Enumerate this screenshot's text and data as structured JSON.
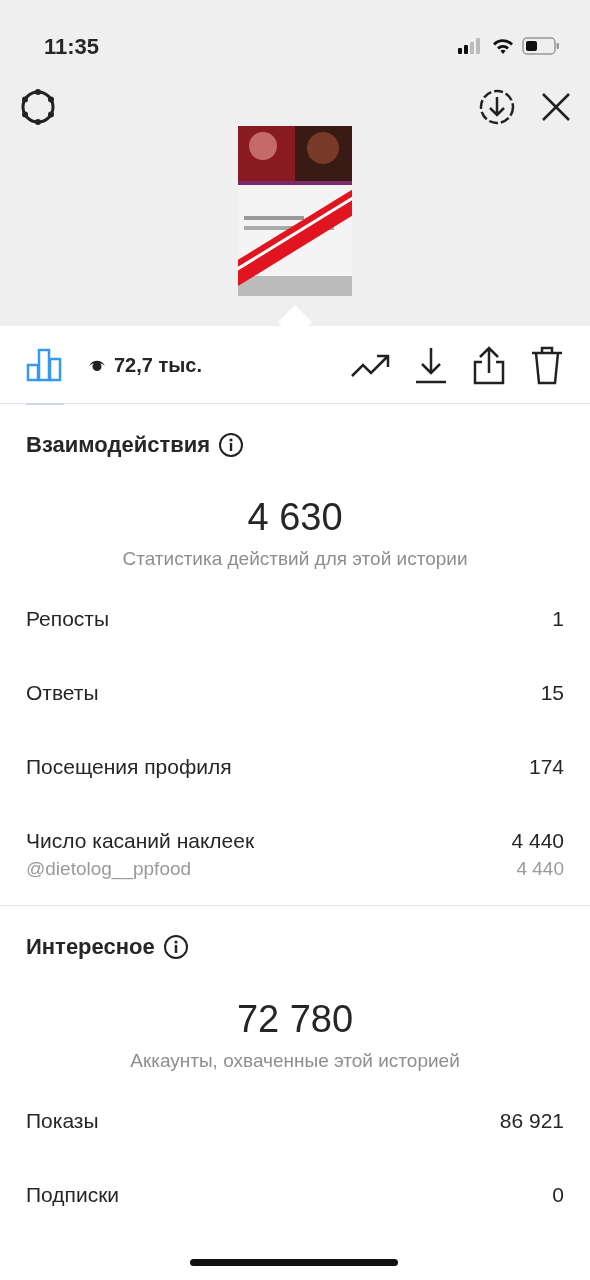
{
  "status_bar": {
    "time": "11:35"
  },
  "toolbar": {
    "tabs": [
      {
        "kind": "insights",
        "selected": true
      }
    ],
    "views": "72,7 тыс."
  },
  "sections": [
    {
      "title": "Взаимодействия",
      "total": "4 630",
      "caption": "Статистика действий для этой истории",
      "rows": [
        {
          "kind": "metric",
          "label": "Репосты",
          "value": "1"
        },
        {
          "kind": "metric",
          "label": "Ответы",
          "value": "15"
        },
        {
          "kind": "metric",
          "label": "Посещения профиля",
          "value": "174"
        },
        {
          "kind": "metric",
          "label": "Число касаний наклеек",
          "value": "4 440"
        },
        {
          "kind": "sub",
          "label": "@dietolog__ppfood",
          "value": "4 440"
        }
      ]
    },
    {
      "title": "Интересное",
      "total": "72 780",
      "caption": "Аккаунты, охваченные этой историей",
      "rows": [
        {
          "kind": "metric",
          "label": "Показы",
          "value": "86 921"
        },
        {
          "kind": "metric",
          "label": "Подписки",
          "value": "0"
        }
      ]
    }
  ]
}
